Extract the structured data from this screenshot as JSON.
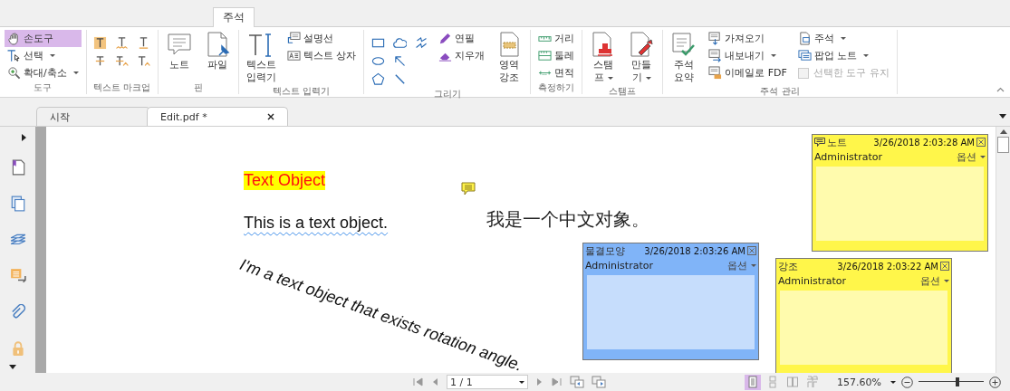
{
  "ribbon_tabs": [
    {
      "label": "주석",
      "selected": true
    }
  ],
  "ribbon_groups": [
    {
      "label": "도구",
      "items": [
        {
          "kind": "small",
          "label": "손도구",
          "selected": true
        },
        {
          "kind": "small",
          "label": "선택",
          "dropdown": true,
          "selected": false
        },
        {
          "kind": "small",
          "label": "확대/축소",
          "dropdown": true,
          "selected": false
        }
      ]
    },
    {
      "label": "텍스트 마크업",
      "items": [
        {
          "kind": "icon"
        },
        {
          "kind": "icon"
        },
        {
          "kind": "icon"
        },
        {
          "kind": "icon"
        },
        {
          "kind": "icon"
        },
        {
          "kind": "icon"
        }
      ]
    },
    {
      "label": "핀",
      "items": [
        {
          "kind": "large",
          "label": "노트"
        },
        {
          "kind": "large",
          "label": "파일"
        }
      ]
    },
    {
      "label": "텍스트 입력기",
      "items": [
        {
          "kind": "large",
          "label": "텍스트\n입력기"
        },
        {
          "kind": "small",
          "label": "설명선"
        },
        {
          "kind": "small",
          "label": "텍스트 상자"
        }
      ]
    },
    {
      "label": "그리기",
      "items": [
        {
          "kind": "icon"
        },
        {
          "kind": "icon"
        },
        {
          "kind": "icon"
        },
        {
          "kind": "icon"
        },
        {
          "kind": "icon"
        },
        {
          "kind": "icon"
        },
        {
          "kind": "icon"
        },
        {
          "kind": "small",
          "label": "연필"
        },
        {
          "kind": "small",
          "label": "지우개"
        },
        {
          "kind": "large",
          "label": "영역\n강조"
        }
      ]
    },
    {
      "label": "측정하기",
      "items": [
        {
          "kind": "small",
          "label": "거리"
        },
        {
          "kind": "small",
          "label": "둘레"
        },
        {
          "kind": "small",
          "label": "면적"
        }
      ]
    },
    {
      "label": "스탬프",
      "items": [
        {
          "kind": "large",
          "label": "스탬\n프",
          "dropdown": true
        },
        {
          "kind": "large",
          "label": "만들\n기",
          "dropdown": true
        }
      ]
    },
    {
      "label": "주석 관리",
      "items": [
        {
          "kind": "large",
          "label": "주석\n요약"
        },
        {
          "kind": "small",
          "label": "가져오기"
        },
        {
          "kind": "small",
          "label": "내보내기",
          "dropdown": true
        },
        {
          "kind": "small",
          "label": "이메일로 FDF"
        },
        {
          "kind": "small",
          "label": "주석",
          "dropdown": true
        },
        {
          "kind": "small",
          "label": "팝업 노트",
          "dropdown": true
        },
        {
          "kind": "checkbox",
          "label": "선택한 도구 유지",
          "checked": false,
          "disabled": true
        }
      ]
    }
  ],
  "doc_tabs": [
    {
      "label": "시작",
      "selected": false
    },
    {
      "label": "Edit.pdf *",
      "selected": true,
      "closable": true
    }
  ],
  "document": {
    "heading": "Text Object",
    "line": "This is a text object.",
    "chinese_text": "我是一个中文对象。",
    "rotated_text": "I'm a text object that exists rotation angle."
  },
  "popups": [
    {
      "title": "노트",
      "timestamp": "3/26/2018 2:03:28 AM",
      "author": "Administrator",
      "options": "옵션",
      "color": "#fff64a",
      "icon": true
    },
    {
      "title": "물결모양",
      "timestamp": "3/26/2018 2:03:26 AM",
      "author": "Administrator",
      "options": "옵션",
      "color": "#80b4f8",
      "icon": false
    },
    {
      "title": "강조",
      "timestamp": "3/26/2018 2:03:22 AM",
      "author": "Administrator",
      "options": "옵션",
      "color": "#fff64a",
      "icon": false
    }
  ],
  "status_bar": {
    "page_field": "1 / 1",
    "view_modes": [
      {
        "selected": true
      },
      {
        "selected": false
      },
      {
        "selected": false
      },
      {
        "selected": false
      }
    ],
    "zoom": "157.60%",
    "zoom_slider": {
      "level": 0.6
    }
  }
}
